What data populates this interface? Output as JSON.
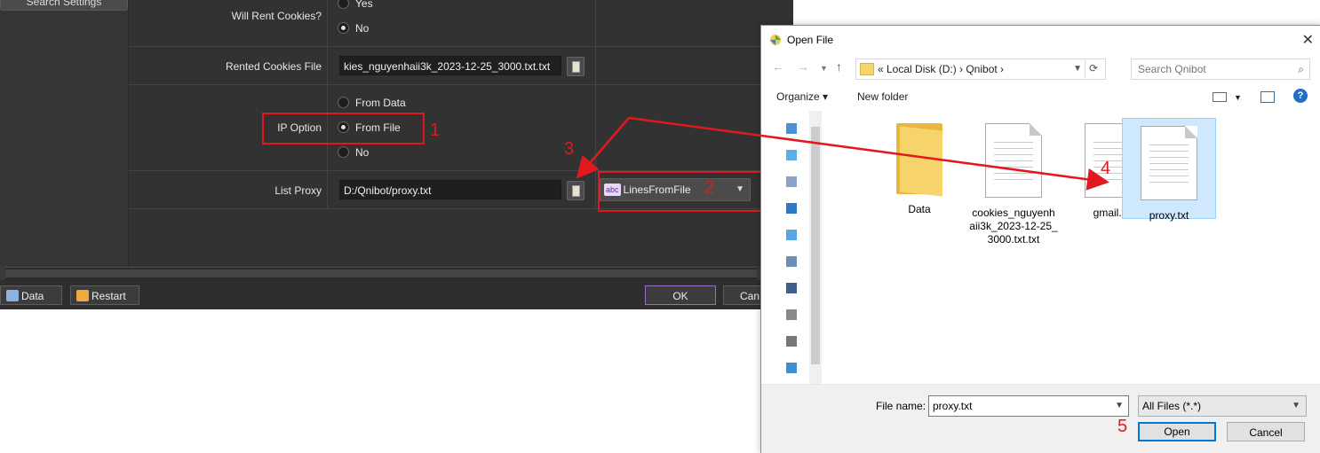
{
  "settings": {
    "search_settings_label": "Search Settings",
    "will_rent_cookies": {
      "label": "Will Rent Cookies?",
      "options": [
        "Yes",
        "No"
      ],
      "selected": "No"
    },
    "rented_cookies_file": {
      "label": "Rented Cookies File",
      "value": "kies_nguyenhaii3k_2023-12-25_3000.txt.txt"
    },
    "ip_option": {
      "label": "IP Option",
      "options": [
        "From Data",
        "From File",
        "No"
      ],
      "selected": "From File"
    },
    "list_proxy": {
      "label": "List Proxy",
      "value": "D:/Qnibot/proxy.txt",
      "mode": "LinesFromFile",
      "mode_badge": "abc"
    },
    "buttons": {
      "data": "Data",
      "restart": "Restart",
      "ok": "OK",
      "cancel": "Can"
    }
  },
  "annotations": [
    "1",
    "2",
    "3",
    "4",
    "5"
  ],
  "dialog": {
    "title": "Open File",
    "close_glyph": "✕",
    "breadcrumb": "«  Local Disk (D:)  ›  Qnibot  ›",
    "search_placeholder": "Search Qnibot",
    "toolbar": {
      "organize": "Organize ▾",
      "new_folder": "New folder"
    },
    "files": [
      {
        "name": "Data",
        "type": "folder",
        "selected": false
      },
      {
        "name": "cookies_nguyenhaii3k_2023-12-25_3000.txt.txt",
        "display_lines": [
          "cookies_nguyenh",
          "aii3k_2023-12-25_",
          "3000.txt.txt"
        ],
        "type": "text",
        "selected": false
      },
      {
        "name": "gmail.txt",
        "type": "text",
        "selected": false
      },
      {
        "name": "proxy.txt",
        "type": "text",
        "selected": true
      }
    ],
    "file_name_label": "File name:",
    "file_name_value": "proxy.txt",
    "file_type_value": "All Files (*.*)",
    "open_label": "Open",
    "cancel_label": "Cancel"
  },
  "colors": {
    "annotation": "#e0191f",
    "dark_bg": "#3a3a3a",
    "selection": "#cde8ff"
  }
}
